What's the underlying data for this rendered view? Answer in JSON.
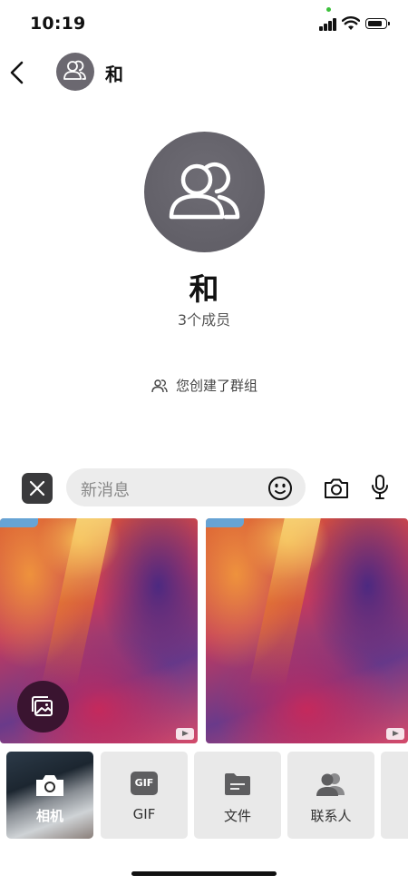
{
  "status_bar": {
    "time": "10:19"
  },
  "header": {
    "title": "和"
  },
  "group": {
    "name": "和",
    "member_count": "3个成员",
    "event_text": "您创建了群组"
  },
  "composer": {
    "placeholder": "新消息"
  },
  "tray": {
    "items": [
      {
        "label": "相机",
        "icon": "camera-icon"
      },
      {
        "label": "GIF",
        "icon": "gif-icon"
      },
      {
        "label": "文件",
        "icon": "folder-icon"
      },
      {
        "label": "联系人",
        "icon": "contacts-icon"
      }
    ],
    "gif_icon_text": "GIF"
  },
  "colors": {
    "avatar": "#5d5b63",
    "input_bg": "#ececec",
    "tray_bg": "#e9e9e9"
  }
}
